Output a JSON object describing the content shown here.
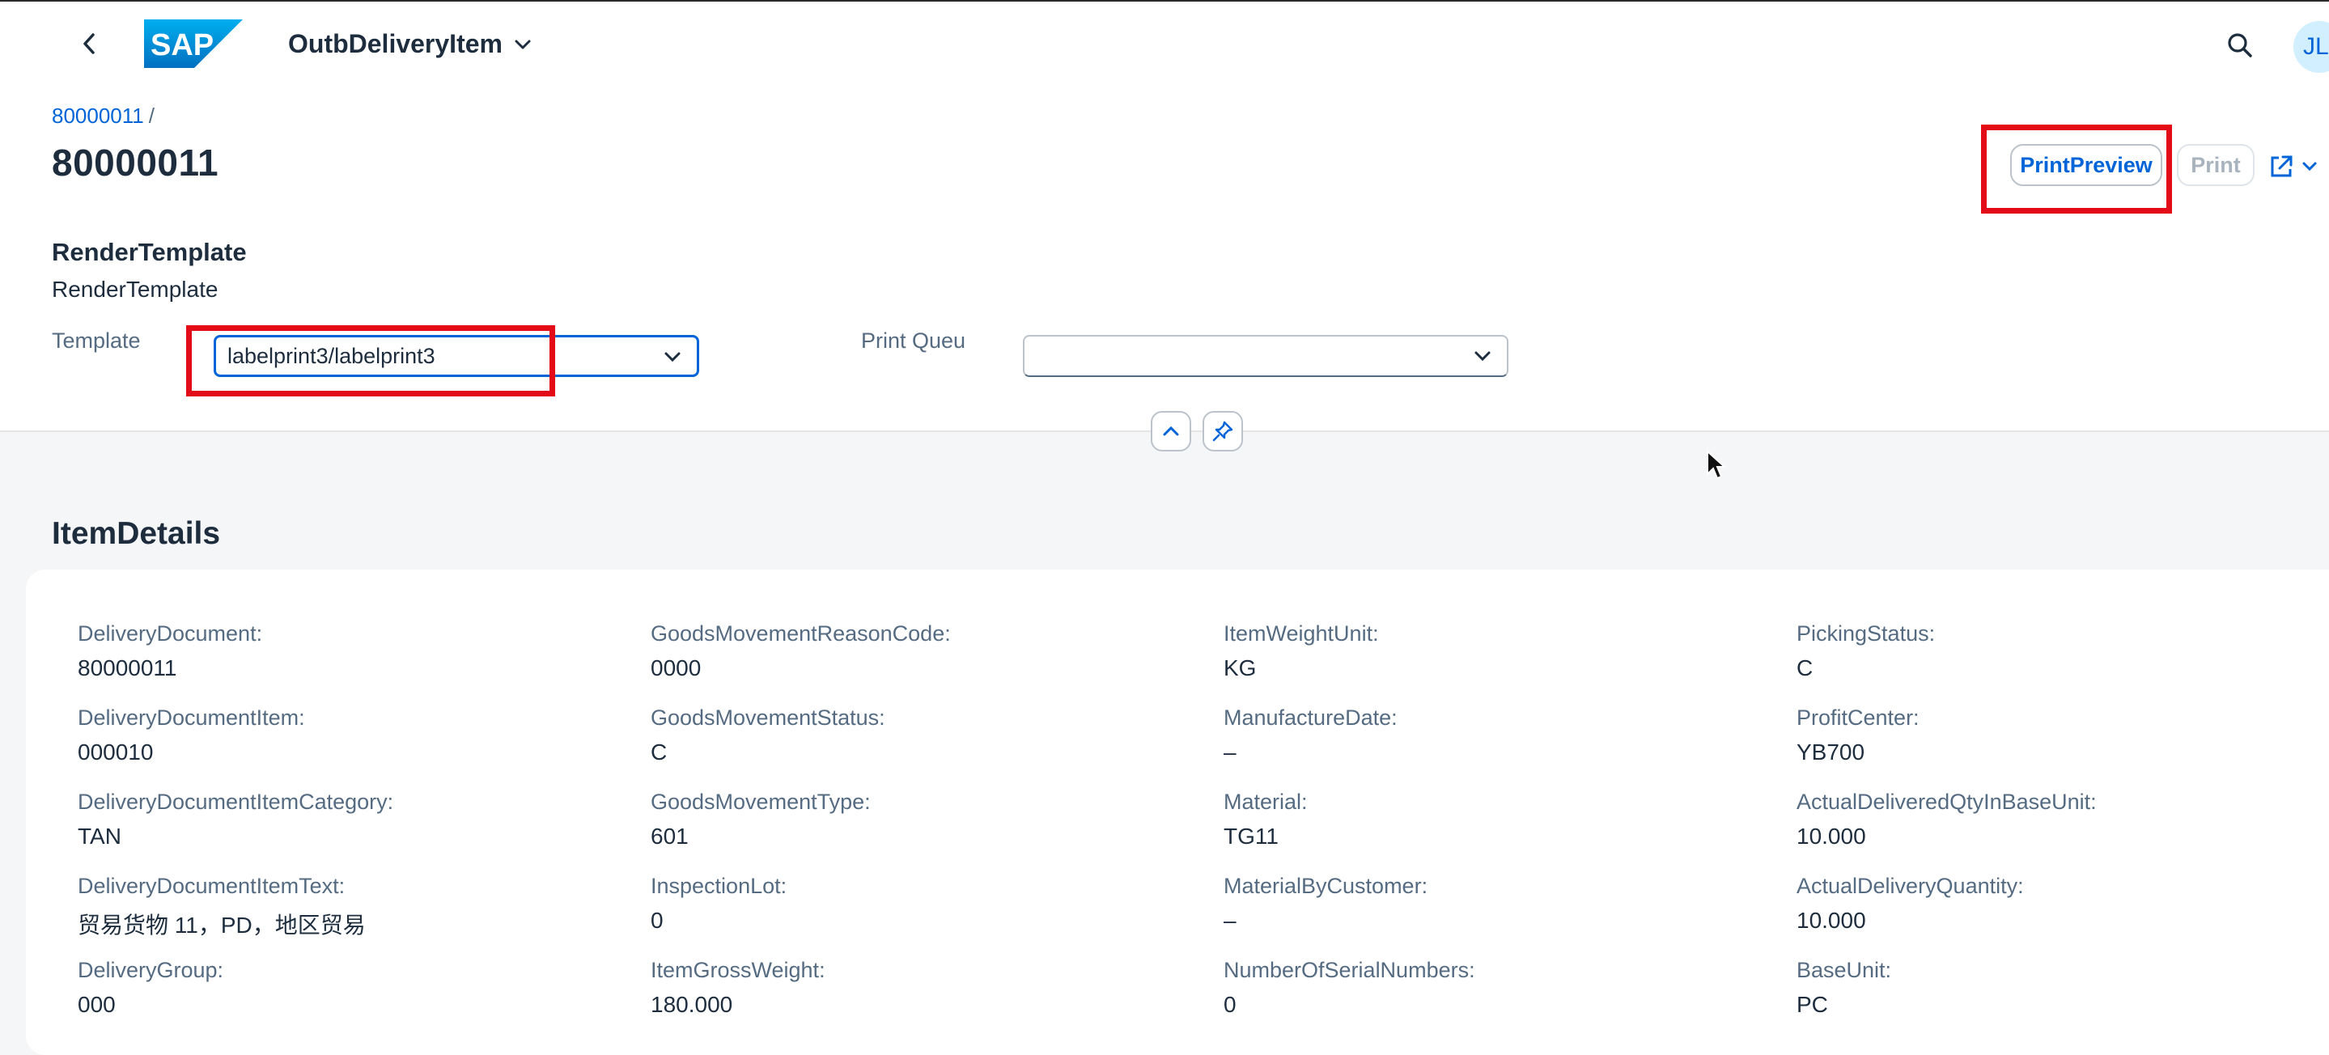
{
  "shell": {
    "app_title": "OutbDeliveryItem",
    "logo_text": "SAP",
    "avatar_initials": "JL",
    "icons": {
      "back": "chevron-left-icon",
      "search": "search-icon",
      "title_menu": "chevron-down-icon"
    }
  },
  "header": {
    "breadcrumb_link": "80000011",
    "breadcrumb_sep": "/",
    "title": "80000011",
    "actions": {
      "print_preview": "PrintPreview",
      "print": "Print"
    },
    "section_title": "RenderTemplate",
    "section_subtitle": "RenderTemplate",
    "template_label": "Template",
    "template_value": "labelprint3/labelprint3",
    "print_queue_label": "Print Queu",
    "print_queue_value": ""
  },
  "content": {
    "section_title": "ItemDetails",
    "columns": [
      [
        {
          "key": "DeliveryDocument:",
          "value": "80000011"
        },
        {
          "key": "DeliveryDocumentItem:",
          "value": "000010"
        },
        {
          "key": "DeliveryDocumentItemCategory:",
          "value": "TAN"
        },
        {
          "key": "DeliveryDocumentItemText:",
          "value": "贸易货物 11，PD，地区贸易"
        },
        {
          "key": "DeliveryGroup:",
          "value": "000"
        }
      ],
      [
        {
          "key": "GoodsMovementReasonCode:",
          "value": "0000"
        },
        {
          "key": "GoodsMovementStatus:",
          "value": "C"
        },
        {
          "key": "GoodsMovementType:",
          "value": "601"
        },
        {
          "key": "InspectionLot:",
          "value": "0"
        },
        {
          "key": "ItemGrossWeight:",
          "value": "180.000"
        }
      ],
      [
        {
          "key": "ItemWeightUnit:",
          "value": "KG"
        },
        {
          "key": "ManufactureDate:",
          "value": "–"
        },
        {
          "key": "Material:",
          "value": "TG11"
        },
        {
          "key": "MaterialByCustomer:",
          "value": "–"
        },
        {
          "key": "NumberOfSerialNumbers:",
          "value": "0"
        }
      ],
      [
        {
          "key": "PickingStatus:",
          "value": "C"
        },
        {
          "key": "ProfitCenter:",
          "value": "YB700"
        },
        {
          "key": "ActualDeliveredQtyInBaseUnit:",
          "value": "10.000"
        },
        {
          "key": "ActualDeliveryQuantity:",
          "value": "10.000"
        },
        {
          "key": "BaseUnit:",
          "value": "PC"
        }
      ]
    ]
  },
  "colors": {
    "accent": "#0064d9",
    "highlight": "#e30b17",
    "text": "#1d2d3e",
    "label": "#556b82",
    "background": "#f5f6f7"
  }
}
